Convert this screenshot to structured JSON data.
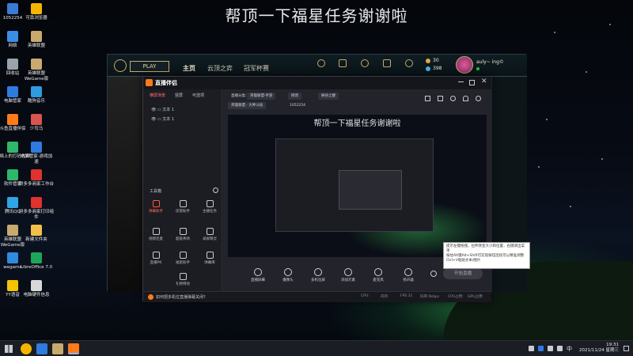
{
  "overlay_title": "帮顶一下福星任务谢谢啦",
  "desktop": {
    "icons": [
      {
        "label": "1052254",
        "color": "#3a7bd5"
      },
      {
        "label": "可靠浏览器",
        "color": "#f5b400"
      },
      {
        "label": "网络",
        "color": "#3a8ee6"
      },
      {
        "label": "英雄联盟",
        "color": "#c8aa6e"
      },
      {
        "label": "回收站",
        "color": "#9aa3ad"
      },
      {
        "label": "英雄联盟 WeGame版",
        "color": "#c8aa6e"
      },
      {
        "label": "电脑管家",
        "color": "#2f7be0"
      },
      {
        "label": "酷狗音乐",
        "color": "#2f9be0"
      },
      {
        "label": "斗鱼直播伴侣",
        "color": "#ff7a1a"
      },
      {
        "label": "少司马",
        "color": "#d9534f"
      },
      {
        "label": "网络上的打码大师",
        "color": "#2fb86a"
      },
      {
        "label": "电脑管家-游戏加速",
        "color": "#2f7be0"
      },
      {
        "label": "软件管家",
        "color": "#2fb86a"
      },
      {
        "label": "拼多多商家工作台",
        "color": "#e0322f"
      },
      {
        "label": "腾讯QQ",
        "color": "#2fa4e7"
      },
      {
        "label": "拼多多商家打印组件",
        "color": "#e0322f"
      },
      {
        "label": "英雄联盟 WeGame版",
        "color": "#c8aa6e"
      },
      {
        "label": "新建文件夹",
        "color": "#f2c04a"
      },
      {
        "label": "wegame",
        "color": "#2f8be0"
      },
      {
        "label": "LibreOffice 7.0",
        "color": "#1ea55a"
      },
      {
        "label": "YY语音",
        "color": "#f5c400"
      },
      {
        "label": "电脑硬件信息",
        "color": "#d8d8d8"
      }
    ]
  },
  "lol": {
    "play_label": "PLAY",
    "nav": [
      "主页",
      "云顶之弈",
      "冠军杯赛"
    ],
    "shortcuts": [
      "",
      "",
      "",
      "",
      "",
      ""
    ],
    "currency": [
      "30",
      "398"
    ],
    "player_name": "auly~ ing©"
  },
  "zb": {
    "app_name": "直播伴侣",
    "tabs": [
      "横屏场景",
      "竖屏",
      "可选项"
    ],
    "scenes": [
      "文本 1",
      "文本 1"
    ],
    "tools_header": "工具箱",
    "tools": [
      "弹幕助手",
      "房管助手",
      "主播任务",
      "视频连麦",
      "超级秀场",
      "录屏精灵",
      "直播PK",
      "福星助手",
      "弹幕库",
      "礼物特效"
    ],
    "bottom_tip": "如何把多机位直播弹幕关闭?",
    "top_info": {
      "prefix": "直播分类:",
      "category": "英雄联盟·手游",
      "room": "1052254",
      "edit": "修改",
      "game": "英雄联盟 · 大神斗技",
      "link": "峡谷之巅"
    },
    "preview_title": "帮顶一下福星任务谢谢啦",
    "bottom_tools": [
      "直播屏幕",
      "摄像头",
      "多机位屏",
      "添加元素",
      "麦克风",
      "扬声器"
    ],
    "start_button": "开始直播",
    "status": [
      "CPU:",
      "内存:",
      "FPS:31",
      "码率:0kbps",
      "CPU占用:",
      "GPU占用:"
    ]
  },
  "tooltip": "提示左键拖拽，拉伸改变大小和位置，右键调出菜单\n按住Alt键Alt+Shift可实现按钮连续可以精准调整\nCtrl+V粘贴文本/图片",
  "taskbar": {
    "time": "19:31",
    "date": "2021/11/24 星期三",
    "lang": "中"
  }
}
